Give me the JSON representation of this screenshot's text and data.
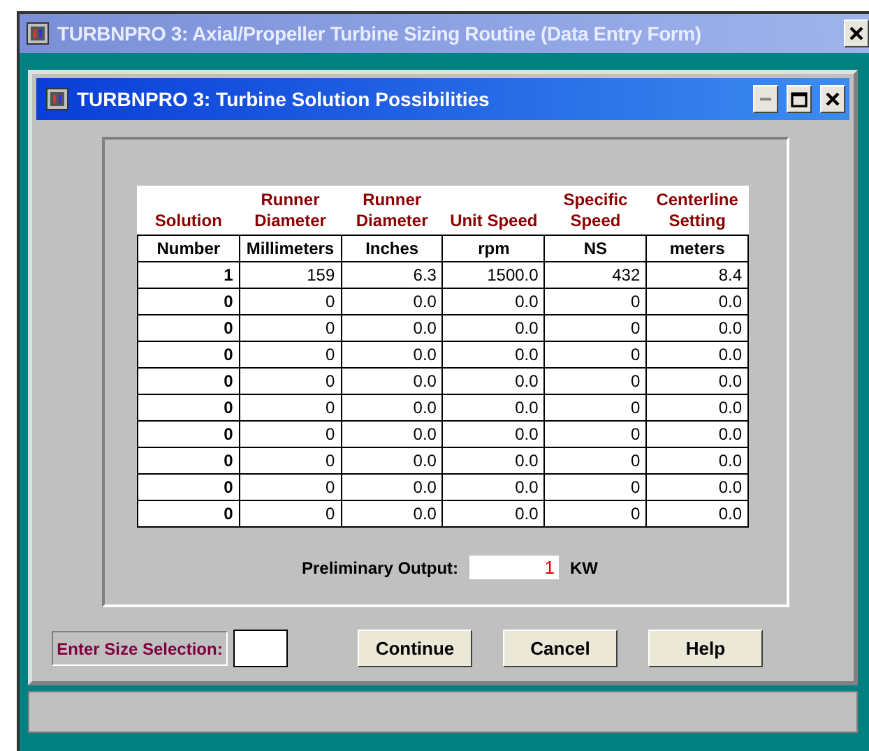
{
  "window": {
    "title": "TURBNPRO 3: Axial/Propeller Turbine Sizing Routine (Data Entry Form)"
  },
  "dialog": {
    "title": "TURBNPRO 3: Turbine Solution Possibilities"
  },
  "table": {
    "columns": [
      {
        "title": "Solution",
        "unit": "Number"
      },
      {
        "title": "Runner Diameter",
        "unit": "Millimeters"
      },
      {
        "title": "Runner Diameter",
        "unit": "Inches"
      },
      {
        "title": "Unit Speed",
        "unit": "rpm"
      },
      {
        "title": "Specific Speed",
        "unit": "NS"
      },
      {
        "title": "Centerline Setting",
        "unit": "meters"
      }
    ],
    "rows": [
      [
        "1",
        "159",
        "6.3",
        "1500.0",
        "432",
        "8.4"
      ],
      [
        "0",
        "0",
        "0.0",
        "0.0",
        "0",
        "0.0"
      ],
      [
        "0",
        "0",
        "0.0",
        "0.0",
        "0",
        "0.0"
      ],
      [
        "0",
        "0",
        "0.0",
        "0.0",
        "0",
        "0.0"
      ],
      [
        "0",
        "0",
        "0.0",
        "0.0",
        "0",
        "0.0"
      ],
      [
        "0",
        "0",
        "0.0",
        "0.0",
        "0",
        "0.0"
      ],
      [
        "0",
        "0",
        "0.0",
        "0.0",
        "0",
        "0.0"
      ],
      [
        "0",
        "0",
        "0.0",
        "0.0",
        "0",
        "0.0"
      ],
      [
        "0",
        "0",
        "0.0",
        "0.0",
        "0",
        "0.0"
      ],
      [
        "0",
        "0",
        "0.0",
        "0.0",
        "0",
        "0.0"
      ]
    ]
  },
  "output": {
    "label": "Preliminary Output:",
    "value": "1",
    "unit": "KW"
  },
  "size_selection": {
    "label": "Enter Size Selection:"
  },
  "buttons": [
    "Continue",
    "Cancel",
    "Help"
  ]
}
